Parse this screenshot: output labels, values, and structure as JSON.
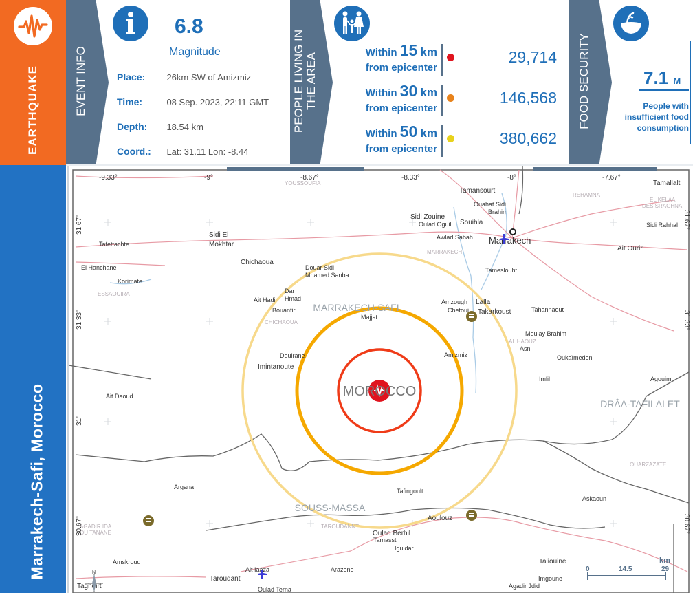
{
  "hazard": {
    "label": "EARTHQUAKE",
    "icon": "seismograph-icon"
  },
  "event_info": {
    "section_label": "EVENT INFO",
    "icon": "info-icon",
    "magnitude_value": "6.8",
    "magnitude_label": "Magnitude",
    "place_key": "Place:",
    "place": "26km SW of Amizmiz",
    "time_key": "Time:",
    "time": "08 Sep. 2023, 22:11 GMT",
    "depth_key": "Depth:",
    "depth": "18.54 km",
    "coord_key": "Coord.:",
    "coord": "Lat: 31.11 Lon: -8.44"
  },
  "people": {
    "section_label_line1": "PEOPLE LIVING IN",
    "section_label_line2": "THE AREA",
    "icon": "family-icon",
    "rings": [
      {
        "within": "Within",
        "distance": "15",
        "unit": "km",
        "from": "from epicenter",
        "population": "29,714",
        "color": "#e0141e"
      },
      {
        "within": "Within",
        "distance": "30",
        "unit": "km",
        "from": "from epicenter",
        "population": "146,568",
        "color": "#e8831c"
      },
      {
        "within": "Within",
        "distance": "50",
        "unit": "km",
        "from": "from epicenter",
        "population": "380,662",
        "color": "#e8d21c"
      }
    ]
  },
  "food_security": {
    "section_label": "FOOD SECURITY",
    "icon": "food-bowl-icon",
    "value": "7.1",
    "unit": "M",
    "description": "People with insufficient food consumption"
  },
  "region": {
    "label": "Marrakech-Safi, Morocco"
  },
  "map": {
    "country_label": "MOROCCO",
    "lon_ticks": [
      "-9.33°",
      "-9°",
      "-8.67°",
      "-8.33°",
      "-8°",
      "-7.67°"
    ],
    "lat_ticks": [
      "31.67°",
      "31.33°",
      "31°",
      "30.67°"
    ],
    "regions": [
      "MARRAKECH-SAFI",
      "SOUSS-MASSA",
      "DRÂA-TAFILALET"
    ],
    "provinces": [
      "YOUSSOUFIA",
      "REHAMNA",
      "EL KELÂA",
      "DES SRAGHNA",
      "MARRAKECH",
      "ESSAOUIRA",
      "CHICHAOUA",
      "AL HAOUZ",
      "OUARZAZATE",
      "AGADIR IDA",
      "OU TANANE",
      "TAROUDANNT"
    ],
    "places": [
      "Tamallalt",
      "Tamansourt",
      "Ouahat Sidi",
      "Brahim",
      "Sidi Zouine",
      "Oulad Oguil",
      "Souihla",
      "Sidi Rahhal",
      "Awlad Sabah",
      "Marrakech",
      "Ait Ourir",
      "Sidi El",
      "Mokhtar",
      "Tafettachte",
      "Chichaoua",
      "El Hanchane",
      "Douar Sidi",
      "Mhamed Sanba",
      "Tameslouht",
      "Korimate",
      "Dar",
      "Ait Hadi",
      "Hmad",
      "Bouanfir",
      "Amzough",
      "Lalla",
      "Chetoui",
      "Takarkoust",
      "Tahannaout",
      "Majjat",
      "Moulay Brahim",
      "Asni",
      "Douirane",
      "Amizmiz",
      "Imintanoute",
      "Oukaïmeden",
      "Imlil",
      "Agouim",
      "Ait Daoud",
      "Argana",
      "Tafingoult",
      "Askaoun",
      "Aoulouz",
      "Oulad Berhil",
      "Tamasst",
      "Iguidar",
      "Amskroud",
      "Ait Iaaza",
      "Arazene",
      "Taliouine",
      "Imgoune",
      "Taroudant",
      "Oulad Terna",
      "Agadir Jdid",
      "Taghdirt"
    ],
    "scale": {
      "unit": "km",
      "ticks": [
        "0",
        "14.5",
        "29"
      ]
    },
    "north_label": "N"
  }
}
